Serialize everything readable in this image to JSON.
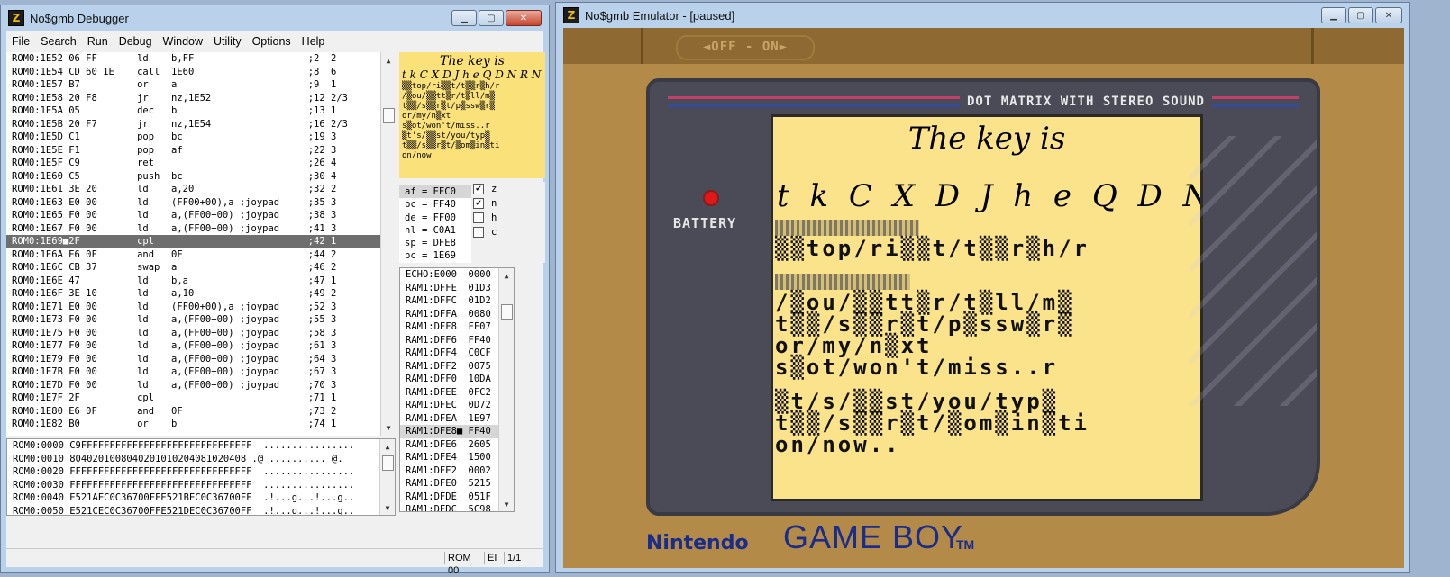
{
  "debugger": {
    "title": "No$gmb Debugger",
    "menu": [
      "File",
      "Search",
      "Run",
      "Debug",
      "Window",
      "Utility",
      "Options",
      "Help"
    ],
    "disasm": [
      "ROM0:1E52 06 FF       ld    b,FF                    ;2  2",
      "ROM0:1E54 CD 60 1E    call  1E60                    ;8  6",
      "ROM0:1E57 B7          or    a                       ;9  1",
      "ROM0:1E58 20 F8       jr    nz,1E52                 ;12 2/3",
      "ROM0:1E5A 05          dec   b                       ;13 1",
      "ROM0:1E5B 20 F7       jr    nz,1E54                 ;16 2/3",
      "ROM0:1E5D C1          pop   bc                      ;19 3",
      "ROM0:1E5E F1          pop   af                      ;22 3",
      "ROM0:1E5F C9          ret                           ;26 4",
      "ROM0:1E60 C5          push  bc                      ;30 4",
      "ROM0:1E61 3E 20       ld    a,20                    ;32 2",
      "ROM0:1E63 E0 00       ld    (FF00+00),a ;joypad     ;35 3",
      "ROM0:1E65 F0 00       ld    a,(FF00+00) ;joypad     ;38 3",
      "ROM0:1E67 F0 00       ld    a,(FF00+00) ;joypad     ;41 3",
      "ROM0:1E69■2F          cpl                           ;42 1",
      "ROM0:1E6A E6 0F       and   0F                      ;44 2",
      "ROM0:1E6C CB 37       swap  a                       ;46 2",
      "ROM0:1E6E 47          ld    b,a                     ;47 1",
      "ROM0:1E6F 3E 10       ld    a,10                    ;49 2",
      "ROM0:1E71 E0 00       ld    (FF00+00),a ;joypad     ;52 3",
      "ROM0:1E73 F0 00       ld    a,(FF00+00) ;joypad     ;55 3",
      "ROM0:1E75 F0 00       ld    a,(FF00+00) ;joypad     ;58 3",
      "ROM0:1E77 F0 00       ld    a,(FF00+00) ;joypad     ;61 3",
      "ROM0:1E79 F0 00       ld    a,(FF00+00) ;joypad     ;64 3",
      "ROM0:1E7B F0 00       ld    a,(FF00+00) ;joypad     ;67 3",
      "ROM0:1E7D F0 00       ld    a,(FF00+00) ;joypad     ;70 3",
      "ROM0:1E7F 2F          cpl                           ;71 1",
      "ROM0:1E80 E6 0F       and   0F                      ;73 2",
      "ROM0:1E82 B0          or    b                       ;74 1"
    ],
    "preview": {
      "title": "The key is",
      "line1": "t k C X D J h e Q D N R N",
      "line2": "▒▒top/ri▒▒t/t▒▒r▒h/r",
      "line3": "/▒ou/▒▒tt▒r/t▒ll/m▒",
      "line4": "t▒▒/s▒▒r▒t/p▒ssw▒r▒",
      "line5": "or/my/n▒xt",
      "line6": "s▒ot/won't/miss..r",
      "line7": "▒t's/▒▒st/you/typ▒",
      "line8": "t▒▒/s▒▒r▒t/▒om▒in▒ti",
      "line9": "on/now"
    },
    "regs": [
      "af = EFC0",
      "bc = FF40",
      "de = FF00",
      "hl = C0A1",
      "sp = DFE8",
      "pc = 1E69"
    ],
    "flags": [
      {
        "name": "z",
        "mark": "✔"
      },
      {
        "name": "n",
        "mark": "✔"
      },
      {
        "name": "h",
        "mark": ""
      },
      {
        "name": "c",
        "mark": ""
      }
    ],
    "stack": [
      "ECHO:E000  0000",
      "RAM1:DFFE  01D3",
      "RAM1:DFFC  01D2",
      "RAM1:DFFA  0080",
      "RAM1:DFF8  FF07",
      "RAM1:DFF6  FF40",
      "RAM1:DFF4  C0CF",
      "RAM1:DFF2  0075",
      "RAM1:DFF0  10DA",
      "RAM1:DFEE  0FC2",
      "RAM1:DFEC  0D72",
      "RAM1:DFEA  1E97",
      "RAM1:DFE8■ FF40",
      "RAM1:DFE6  2605",
      "RAM1:DFE4  1500",
      "RAM1:DFE2  0002",
      "RAM1:DFE0  5215",
      "RAM1:DFDE  051F",
      "RAM1:DFDC  5C98"
    ],
    "memdump": [
      "ROM0:0000 C9FFFFFFFFFFFFFFFFFFFFFFFFFFFFFF  ................",
      "ROM0:0010 8040201008040201010204081020408 .@ .......... @.",
      "ROM0:0020 FFFFFFFFFFFFFFFFFFFFFFFFFFFFFFFF  ................",
      "ROM0:0030 FFFFFFFFFFFFFFFFFFFFFFFFFFFFFFFF  ................",
      "ROM0:0040 E521AEC0C36700FFE521BEC0C36700FF  .!...g...!...g..",
      "ROM0:0050 E521CEC0C36700FFE521DEC0C36700FF  .!...g...!...g.."
    ],
    "status": {
      "bank": "ROM 00",
      "ei": "EI",
      "page": "1/1"
    }
  },
  "emulator": {
    "title": "No$gmb Emulator - [paused]",
    "switch_label": "◄OFF - ON►",
    "bezel_label": "DOT MATRIX WITH STEREO SOUND",
    "battery_label": "BATTERY",
    "screen": {
      "title": "The key is",
      "cursive": "t k C X D J h e Q D N R N",
      "line2": "▒▒top/ri▒▒t/t▒▒r▒h/r",
      "line3": "/▒ou/▒▒tt▒r/t▒ll/m▒",
      "line4": "t▒▒/s▒▒r▒t/p▒ssw▒r▒",
      "line5": "or/my/n▒xt",
      "line6": "s▒ot/won't/miss..r",
      "line7": "▒t/s/▒▒st/you/typ▒",
      "line8": "t▒▒/s▒▒r▒t/▒om▒in▒ti",
      "line9": "on/now.."
    },
    "brand": "Nintendo",
    "product": "GAME BOY",
    "tm": "TM",
    "colors": {
      "stripe_top": "#c0406a",
      "stripe_bottom": "#3a4a9a",
      "screen": "#fbe38b",
      "led": "#e01818"
    }
  }
}
